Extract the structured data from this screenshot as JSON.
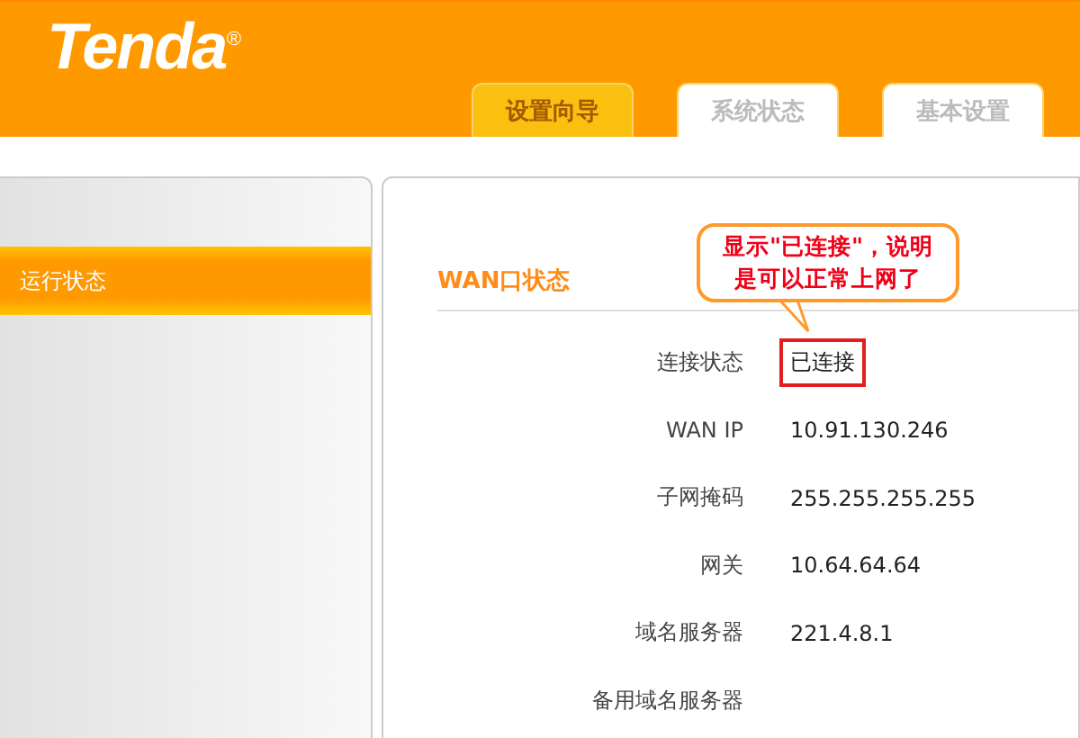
{
  "logo": "Tenda$^{®}$",
  "tabs": [
    {
      "label": "设置向导",
      "selected": true
    },
    {
      "label": "系统状态",
      "selected": false
    },
    {
      "label": "基本设置",
      "selected": false
    }
  ],
  "sidebar": {
    "items": [
      {
        "label": "运行状态",
        "selected": true
      }
    ]
  },
  "section": {
    "title": "WAN口状态",
    "connection": {
      "label": "连接状态",
      "value": "已连接"
    },
    "rows": [
      {
        "label": "WAN IP",
        "value": "10.91.130.246"
      },
      {
        "label": "子网掩码",
        "value": "255.255.255.255"
      },
      {
        "label": "网关",
        "value": "10.64.64.64"
      },
      {
        "label": "域名服务器",
        "value": "221.4.8.1"
      },
      {
        "label": "备用域名服务器"
      }
    ]
  },
  "callout": "显示\"已连接\"，说明是可以正常上网了"
}
